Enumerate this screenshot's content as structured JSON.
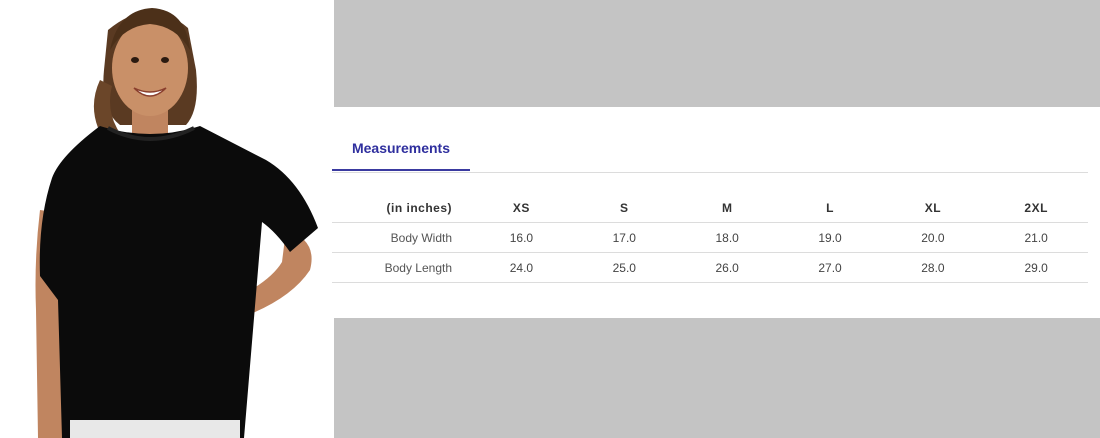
{
  "product_image": {
    "alt": "Girl wearing a black short-sleeve t-shirt",
    "shirt_color": "#0b0b0b"
  },
  "tabs": [
    {
      "label": "Measurements",
      "active": true
    }
  ],
  "accent_color": "#2f2f9e",
  "size_chart": {
    "unit_header": "(in inches)",
    "sizes": [
      "XS",
      "S",
      "M",
      "L",
      "XL",
      "2XL"
    ],
    "rows": [
      {
        "label": "Body Width",
        "values": [
          "16.0",
          "17.0",
          "18.0",
          "19.0",
          "20.0",
          "21.0"
        ]
      },
      {
        "label": "Body Length",
        "values": [
          "24.0",
          "25.0",
          "26.0",
          "27.0",
          "28.0",
          "29.0"
        ]
      }
    ]
  }
}
